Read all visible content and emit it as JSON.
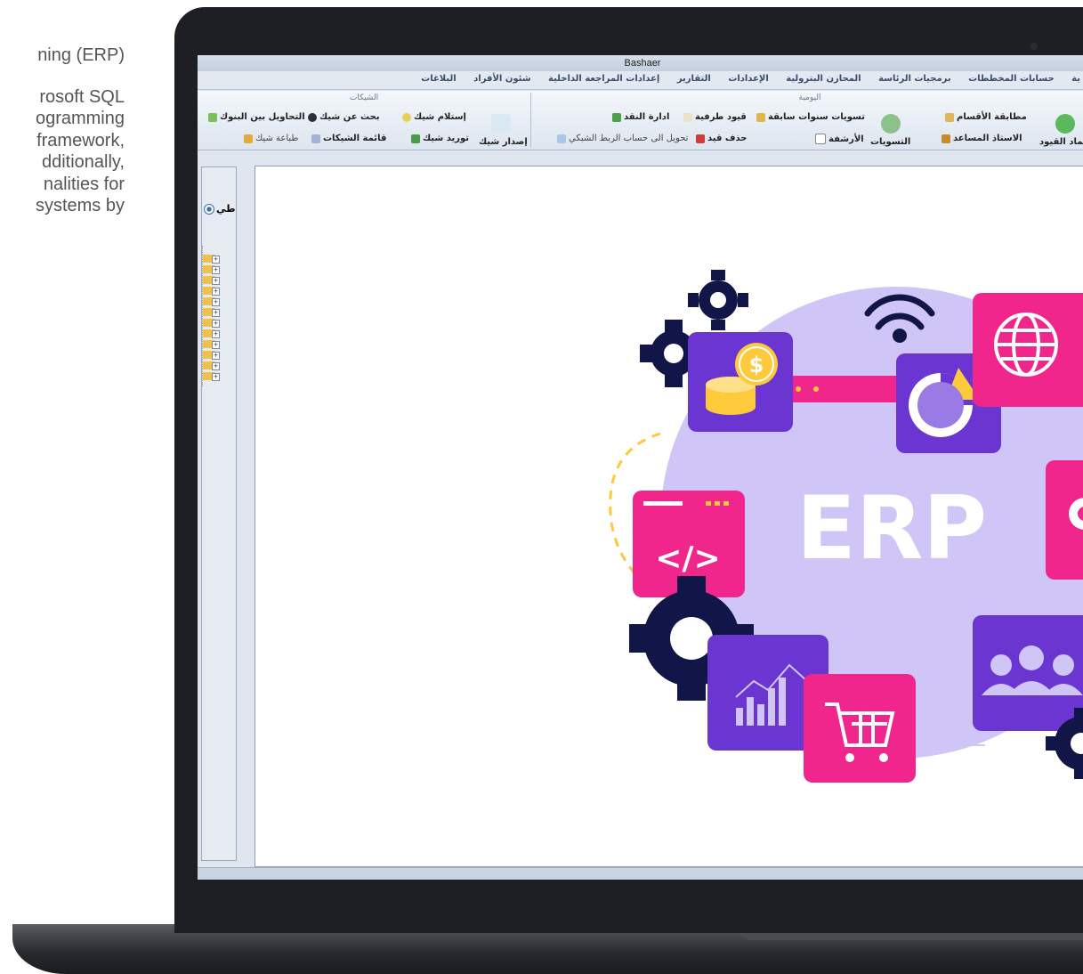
{
  "background_text": {
    "lines": [
      "ning (ERP)",
      "rosoft SQL",
      "ogramming",
      "framework,",
      "dditionally,",
      "nalities for",
      "systems by"
    ]
  },
  "window": {
    "title": "Bashaer"
  },
  "menu": {
    "items": [
      "البلاغات",
      "شئون الأفراد",
      "إعدادات المراجعة الداخلية",
      "التقارير",
      "الإعدادات",
      "المحازن البترولية",
      "برمجيات الرئاسة",
      "حسابات المخططات",
      "ية"
    ]
  },
  "ribbon": {
    "daily_group_title": "اليومية",
    "checks_group_title": "الشيكات",
    "daily": {
      "match_departments": "مطابقة الأقسام",
      "helper_professor": "الاستاذ المساعد",
      "approve_entries": "عتماد القيود",
      "settlements": "التسويات",
      "prior_years_settlements": "تسويات سنوات سابقة",
      "archive": "الأرشفة",
      "side_entries": "قيود طرفية",
      "delete_entry": "حذف قيد",
      "cash_management": "ادارة النقد",
      "transfer_network": "تحويل الى حساب الربط الشبكي"
    },
    "checks": {
      "issue_check": "إصدار شيك",
      "receive_check": "إستلام شيك",
      "supply_check": "توريد شيك",
      "search_check": "بحث عن شيك",
      "checks_list": "قائمة الشيكات",
      "bank_transfers": "التحاويل بين البنوك",
      "print_check": "طباعة شيك"
    }
  },
  "left_panel": {
    "radio_label": "طي"
  },
  "illustration": {
    "text": "ERP",
    "dollar": "$",
    "code": "</>"
  },
  "colors": {
    "pink": "#F0268D",
    "purple": "#6A35D0",
    "lavender": "#CFC5F7",
    "navy": "#111547",
    "yellow": "#FFC93C"
  }
}
